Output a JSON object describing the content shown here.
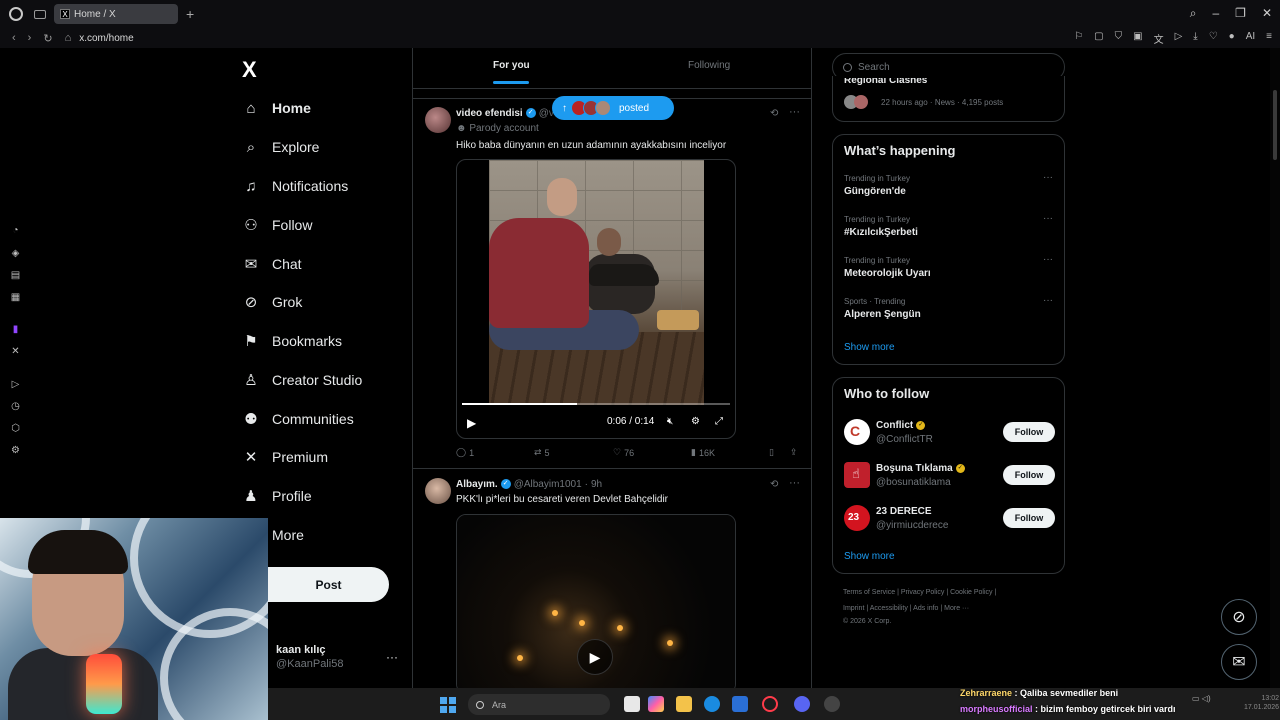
{
  "browser": {
    "tab_title": "Home / X",
    "tab_favicon": "X",
    "url": "x.com/home",
    "new_tab": "+"
  },
  "nav": {
    "logo": "X",
    "items": [
      {
        "label": "Home",
        "icon": "home-icon",
        "active": true
      },
      {
        "label": "Explore",
        "icon": "search-icon"
      },
      {
        "label": "Notifications",
        "icon": "bell-icon"
      },
      {
        "label": "Follow",
        "icon": "person-add-icon"
      },
      {
        "label": "Chat",
        "icon": "mail-icon"
      },
      {
        "label": "Grok",
        "icon": "grok-icon"
      },
      {
        "label": "Bookmarks",
        "icon": "bookmark-icon"
      },
      {
        "label": "Creator Studio",
        "icon": "creator-studio-icon"
      },
      {
        "label": "Communities",
        "icon": "communities-icon"
      },
      {
        "label": "Premium",
        "icon": "x-premium-icon"
      },
      {
        "label": "Profile",
        "icon": "profile-icon"
      },
      {
        "label": "More",
        "icon": "more-icon"
      }
    ],
    "post_button": "Post",
    "account": {
      "name": "kaan kılıç",
      "handle": "@KaanPali58",
      "more": "···"
    }
  },
  "feed": {
    "tabs": [
      {
        "label": "For you",
        "active": true
      },
      {
        "label": "Following",
        "active": false
      }
    ],
    "posted_pill": {
      "label": "posted",
      "arrow": "↑"
    },
    "tweets": [
      {
        "name": "video efendisi",
        "handle": "@v",
        "badge": "Parody account",
        "text": "Hiko baba dünyanın en uzun adamının ayakkabısını inceliyor",
        "video": {
          "time": "0:06 / 0:14",
          "progress": 0.43
        },
        "stats": {
          "replies": "1",
          "reposts": "5",
          "likes": "76",
          "views": "16K"
        }
      },
      {
        "name": "Albayım.",
        "handle": "@Albayim1001",
        "time": "9h",
        "text": "PKK'lı pi*leri bu cesareti veren Devlet Bahçelidir",
        "video": {
          "play": "▶"
        }
      }
    ]
  },
  "sidebar": {
    "search_placeholder": "Search",
    "news": {
      "title_partial": "Regional Clashes",
      "meta": "22 hours ago · News · 4,195 posts"
    },
    "whats_happening": {
      "title": "What’s happening",
      "trends": [
        {
          "meta": "Trending in Turkey",
          "name": "Güngören'de"
        },
        {
          "meta": "Trending in Turkey",
          "name": "#KızılcıkŞerbeti"
        },
        {
          "meta": "Trending in Turkey",
          "name": "Meteorolojik Uyarı"
        },
        {
          "meta": "Sports · Trending",
          "name": "Alperen Şengün"
        }
      ],
      "show_more": "Show more"
    },
    "who_to_follow": {
      "title": "Who to follow",
      "accounts": [
        {
          "name": "Conflict",
          "handle": "@ConflictTR",
          "button": "Follow"
        },
        {
          "name": "Boşuna Tıklama",
          "handle": "@bosunatiklama",
          "button": "Follow"
        },
        {
          "name": "23 DERECE",
          "handle": "@yirmiucderece",
          "button": "Follow"
        }
      ],
      "show_more": "Show more"
    },
    "footer": {
      "line1": "Terms of Service  |  Privacy Policy  |  Cookie Policy  |",
      "line2": "Imprint  |  Accessibility  |  Ads info  |  More ···",
      "line3": "© 2026 X Corp."
    }
  },
  "taskbar": {
    "search_label": "Ara",
    "chat": [
      {
        "user": "Zehrarraene",
        "message": " : Qaliba sevmediler beni"
      },
      {
        "user": "morpheusofficial",
        "message": " : bizim femboy getircek biri vardı"
      }
    ],
    "clock_time": "13:02",
    "clock_date": "17.01.2026"
  },
  "colors": {
    "accent": "#1d9bf0",
    "bg": "#000000",
    "border": "#2f3336",
    "muted": "#71767b"
  }
}
